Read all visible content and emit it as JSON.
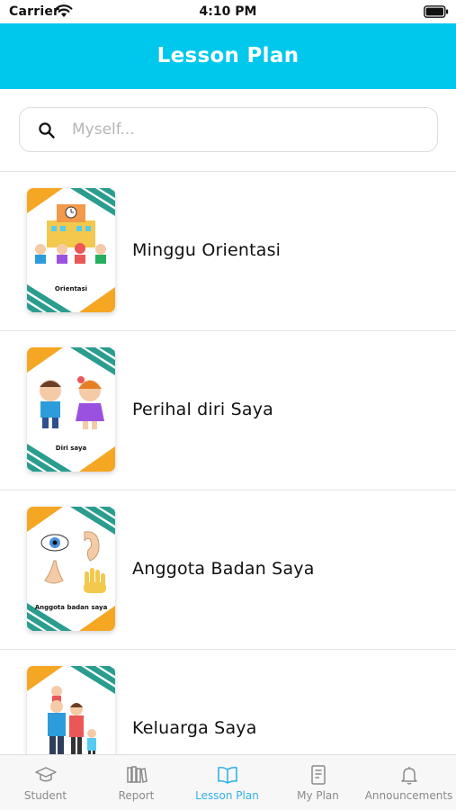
{
  "status_bar": {
    "carrier": "Carrier",
    "time": "4:10 PM"
  },
  "header": {
    "title": "Lesson Plan"
  },
  "search": {
    "placeholder": "Myself..."
  },
  "lessons": [
    {
      "title": "Minggu Orientasi",
      "thumb_caption": "Orientasi",
      "icon": "school-kids-image"
    },
    {
      "title": "Perihal diri Saya",
      "thumb_caption": "Diri saya",
      "icon": "boy-girl-image"
    },
    {
      "title": "Anggota Badan Saya",
      "thumb_caption": "Anggota badan saya",
      "icon": "eye-ear-nose-hand-image"
    },
    {
      "title": "Keluarga Saya",
      "thumb_caption": "",
      "icon": "family-image"
    }
  ],
  "tabs": [
    {
      "label": "Student",
      "icon": "graduation-cap-icon",
      "active": false
    },
    {
      "label": "Report",
      "icon": "books-icon",
      "active": false
    },
    {
      "label": "Lesson Plan",
      "icon": "open-book-icon",
      "active": true
    },
    {
      "label": "My Plan",
      "icon": "notebook-icon",
      "active": false
    },
    {
      "label": "Announcements",
      "icon": "bell-icon",
      "active": false
    }
  ],
  "colors": {
    "header": "#00c8ec",
    "active_tab": "#2fb2e6",
    "stripe_teal": "#2a9d8f",
    "stripe_orange": "#f5a623"
  }
}
